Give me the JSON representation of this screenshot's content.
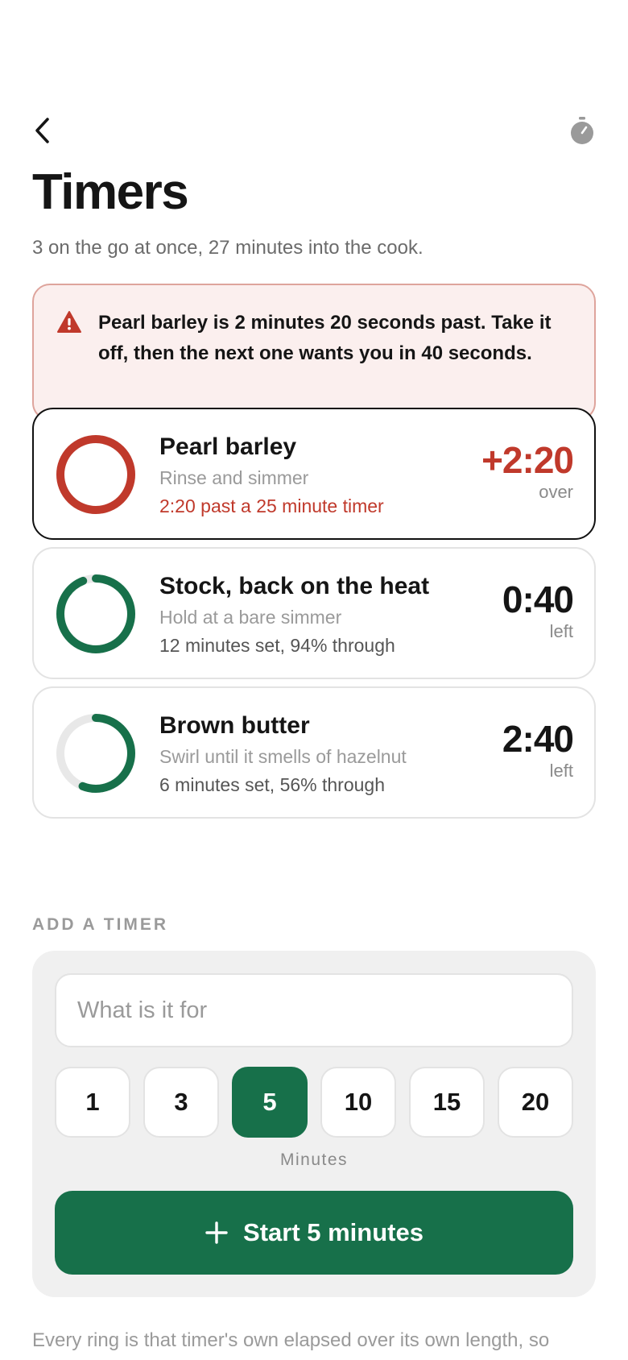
{
  "header": {
    "back_icon": "chevron-left-icon",
    "timer_icon": "stopwatch-icon"
  },
  "page": {
    "title": "Timers",
    "subtitle": "3 on the go at once, 27 minutes into the cook."
  },
  "alert": {
    "icon": "warning-triangle-icon",
    "text": "Pearl barley is 2 minutes 20 seconds past. Take it off, then the next one wants you in 40 seconds.",
    "colors": {
      "background": "#fbefee",
      "border": "#dea49c",
      "icon": "#c0392b"
    }
  },
  "timers": [
    {
      "name": "Pearl barley",
      "description": "Rinse and simmer",
      "progress_text": "2:20 past a 25 minute timer",
      "time": "+2:20",
      "unit": "over",
      "state": "over",
      "fraction": 1.0
    },
    {
      "name": "Stock, back on the heat",
      "description": "Hold at a bare simmer",
      "progress_text": "12 minutes set, 94% through",
      "time": "0:40",
      "unit": "left",
      "state": "running",
      "fraction": 0.94
    },
    {
      "name": "Brown butter",
      "description": "Swirl until it smells of hazelnut",
      "progress_text": "6 minutes set, 56% through",
      "time": "2:40",
      "unit": "left",
      "state": "running",
      "fraction": 0.56
    }
  ],
  "add_timer": {
    "section_label": "ADD A TIMER",
    "input_placeholder": "What is it for",
    "input_value": "",
    "minute_options": [
      "1",
      "3",
      "5",
      "10",
      "15",
      "20"
    ],
    "selected_minutes": "5",
    "minutes_caption": "Minutes",
    "start_label": "Start 5 minutes",
    "start_icon": "plus-icon"
  },
  "footnote": "Every ring is that timer's own elapsed over its own length, so",
  "colors": {
    "accent": "#17704a",
    "over": "#c0392b",
    "ring_track": "#e8e8e8",
    "text_primary": "#151515",
    "text_muted": "#9a9a9a"
  }
}
